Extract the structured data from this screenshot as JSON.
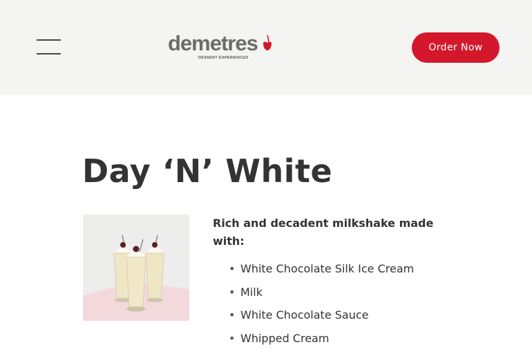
{
  "header": {
    "menu_icon": "hamburger-menu-icon",
    "logo": {
      "wordmark": "demetres",
      "tagline": "DESSERT EXPERIENCED",
      "cherry_color": "#d4182c"
    },
    "order_button_label": "Order Now",
    "background": "#f4f4f3"
  },
  "product": {
    "title": "Day ‘N’ White",
    "image": "milkshake-glasses-image",
    "intro": "Rich and decadent milkshake made with:",
    "ingredients": [
      "White Chocolate Silk Ice Cream",
      "Milk",
      "White Chocolate Sauce",
      "Whipped Cream"
    ]
  },
  "colors": {
    "accent": "#d4182c",
    "text": "#333333"
  }
}
